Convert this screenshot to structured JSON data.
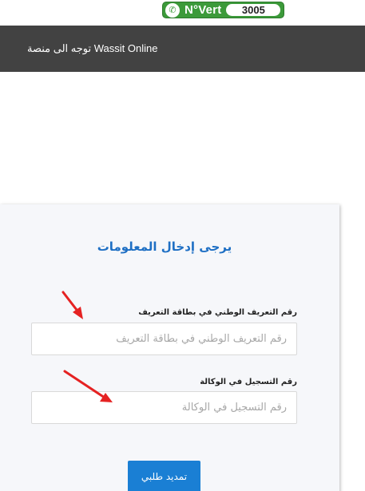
{
  "badge": {
    "label": "N°Vert",
    "number": "3005",
    "icon": "phone-icon",
    "color": "#3c9a3a"
  },
  "header": {
    "cta_text": "توجه الى منصة Wassit Online",
    "bg_color": "#424242"
  },
  "form": {
    "title": "يرجى إدخال المعلومات",
    "title_color": "#1e6fc4",
    "fields": [
      {
        "label": "رقم التعريف الوطني في بطاقة التعريف",
        "placeholder": "رقم التعريف الوطني في بطاقة التعريف",
        "value": ""
      },
      {
        "label": "رقم التسجيل في الوكالة",
        "placeholder": "رقم التسجيل في الوكالة",
        "value": ""
      }
    ],
    "submit_label": "تمديد طلبي",
    "submit_color": "#1a7fd4"
  },
  "annotations": {
    "arrow_color": "#e52222",
    "arrow_icon": "red-arrow-icon"
  }
}
